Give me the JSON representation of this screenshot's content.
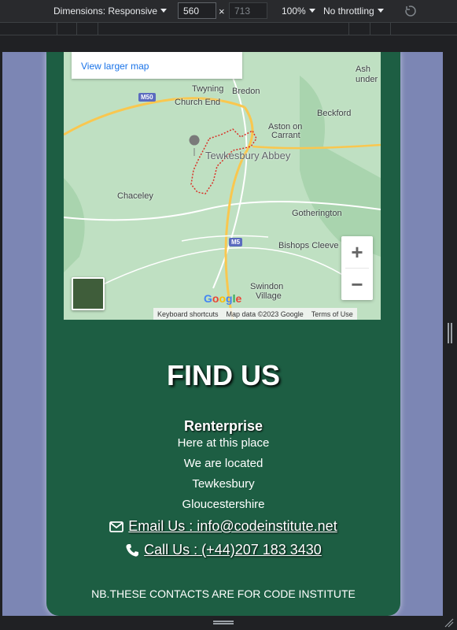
{
  "devtools": {
    "dimensions_label": "Dimensions: Responsive",
    "width_value": "560",
    "times": "×",
    "height_placeholder": "713",
    "zoom": "100%",
    "throttling": "No throttling"
  },
  "map": {
    "larger_map_link": "View larger map",
    "places": {
      "ashton_under": "Ash",
      "ashton_under2": "under",
      "twyning": "Twyning",
      "church_end": "Church End",
      "bredon": "Bredon",
      "beckford": "Beckford",
      "aston_on": "Aston on",
      "carrant": "Carrant",
      "tewkesbury_abbey": "Tewkesbury Abbey",
      "chaceley": "Chaceley",
      "gotherington": "Gotherington",
      "bishops_cleeve": "Bishops Cleeve",
      "swindon": "Swindon",
      "village": "Village"
    },
    "road_m50": "M50",
    "road_m5": "M5",
    "zoom_in": "+",
    "zoom_out": "−",
    "google_logo": "Google",
    "footer": {
      "shortcuts": "Keyboard shortcuts",
      "map_data": "Map data ©2023 Google",
      "terms": "Terms of Use"
    },
    "colors": {
      "water_land": "#c8e6c9",
      "motorway": "#f9c74f",
      "boundary": "#d93025"
    }
  },
  "content": {
    "heading": "FIND US",
    "company": "Renterprise",
    "address": [
      "Here at this place",
      "We are located",
      "Tewkesbury",
      "Gloucestershire"
    ],
    "email": "Email Us : info@codeinstitute.net",
    "phone": "Call Us : (+44)207 183 3430",
    "note": "NB.THESE CONTACTS ARE FOR CODE INSTITUTE",
    "email_icon": "envelope-icon",
    "phone_icon": "phone-icon"
  },
  "colors": {
    "page_bg": "#7c86b4",
    "card_bg": "#1d5e43",
    "devtools_bg": "#292a2d"
  }
}
